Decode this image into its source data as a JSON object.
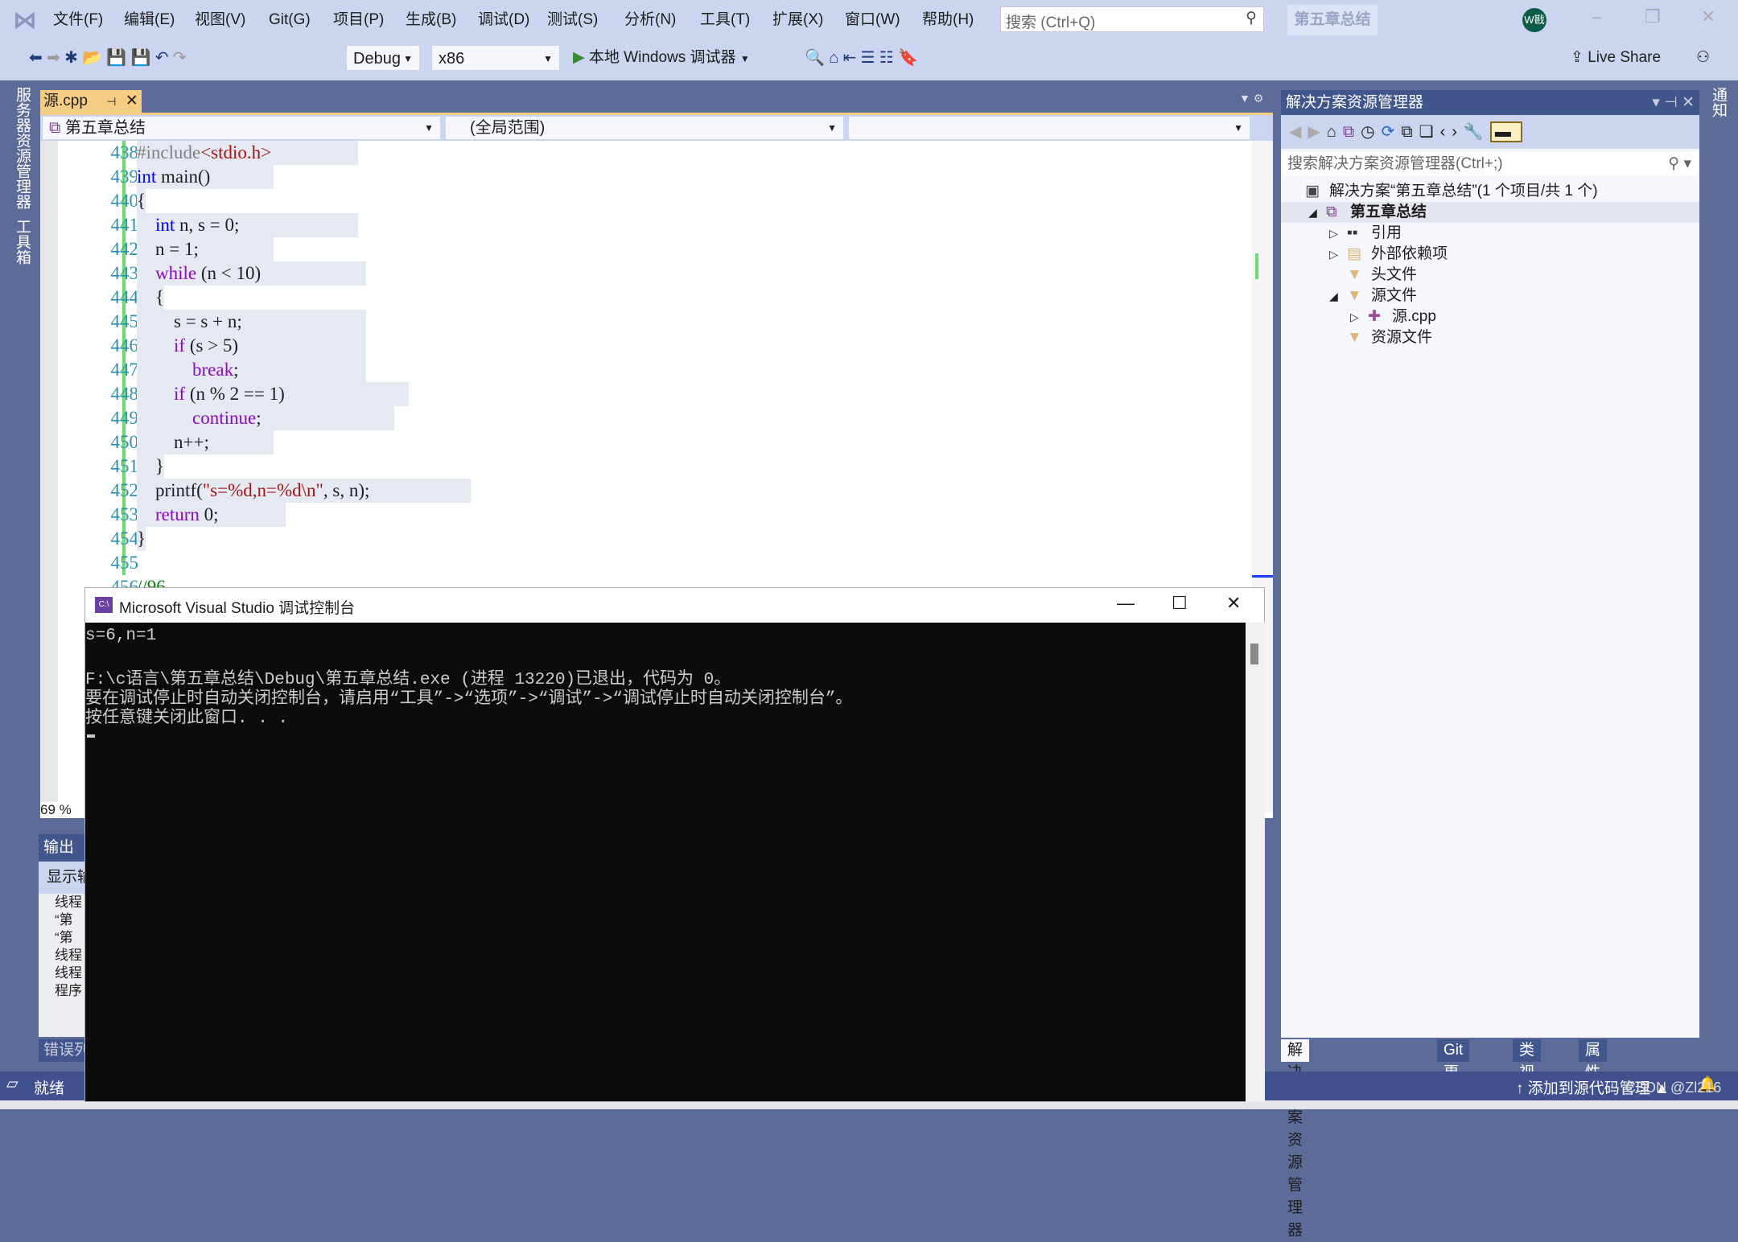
{
  "menu": [
    "文件(F)",
    "编辑(E)",
    "视图(V)",
    "Git(G)",
    "项目(P)",
    "生成(B)",
    "调试(D)",
    "测试(S)",
    "分析(N)",
    "工具(T)",
    "扩展(X)",
    "窗口(W)",
    "帮助(H)"
  ],
  "search": {
    "placeholder": "搜索 (Ctrl+Q)"
  },
  "solution_name_badge": "第五章总结",
  "avatar": "W戡",
  "toolbar": {
    "config": "Debug",
    "platform": "x86",
    "run_label": "本地 Windows 调试器",
    "live_share": "Live Share"
  },
  "left_tabs": [
    "服务器资源管理器",
    "工具箱"
  ],
  "right_tab": "通知",
  "editor": {
    "tab": "源.cpp",
    "project_combo": "第五章总结",
    "scope_combo": "(全局范围)",
    "zoom": "69 %",
    "lines": [
      {
        "n": "438",
        "t": "#include<stdio.h>"
      },
      {
        "n": "439",
        "t": "int main()"
      },
      {
        "n": "440",
        "t": "{"
      },
      {
        "n": "441",
        "t": "    int n, s = 0;"
      },
      {
        "n": "442",
        "t": "    n = 1;"
      },
      {
        "n": "443",
        "t": "    while (n < 10)"
      },
      {
        "n": "444",
        "t": "    {"
      },
      {
        "n": "445",
        "t": "        s = s + n;"
      },
      {
        "n": "446",
        "t": "        if (s > 5)"
      },
      {
        "n": "447",
        "t": "            break;"
      },
      {
        "n": "448",
        "t": "        if (n % 2 == 1)"
      },
      {
        "n": "449",
        "t": "            continue;"
      },
      {
        "n": "450",
        "t": "        n++;"
      },
      {
        "n": "451",
        "t": "    }"
      },
      {
        "n": "452",
        "t": "    printf(\"s=%d,n=%d\\n\", s, n);"
      },
      {
        "n": "453",
        "t": "    return 0;"
      },
      {
        "n": "454",
        "t": "}"
      },
      {
        "n": "455",
        "t": ""
      },
      {
        "n": "456",
        "t": "//96"
      }
    ]
  },
  "output": {
    "title": "输出",
    "show_label": "显示输",
    "lines": [
      "线程",
      "“第",
      "“第",
      "线程",
      "线程",
      "程序"
    ],
    "error_tab": "错误列"
  },
  "console": {
    "title": "Microsoft Visual Studio 调试控制台",
    "lines": [
      "s=6,n=1",
      "",
      "F:\\c语言\\第五章总结\\Debug\\第五章总结.exe (进程 13220)已退出，代码为 0。",
      "要在调试停止时自动关闭控制台，请启用“工具”->“选项”->“调试”->“调试停止时自动关闭控制台”。",
      "按任意键关闭此窗口. . ."
    ]
  },
  "solution_explorer": {
    "title": "解决方案资源管理器",
    "search_placeholder": "搜索解决方案资源管理器(Ctrl+;)",
    "tree": [
      {
        "label": "解决方案“第五章总结”(1 个项目/共 1 个)",
        "indent": 0,
        "exp": ""
      },
      {
        "label": "第五章总结",
        "indent": 1,
        "exp": "◢",
        "bold": true
      },
      {
        "label": "引用",
        "indent": 2,
        "exp": "▷"
      },
      {
        "label": "外部依赖项",
        "indent": 2,
        "exp": "▷"
      },
      {
        "label": "头文件",
        "indent": 2,
        "exp": ""
      },
      {
        "label": "源文件",
        "indent": 2,
        "exp": "◢"
      },
      {
        "label": "源.cpp",
        "indent": 3,
        "exp": "▷"
      },
      {
        "label": "资源文件",
        "indent": 2,
        "exp": ""
      }
    ],
    "bottom_tabs": [
      "解决方案资源管理器",
      "Git 更改",
      "类视图",
      "属性"
    ]
  },
  "status": {
    "ready": "就绪",
    "source_control": "添加到源代码管理"
  },
  "watermark": "CSDN @Zl216"
}
